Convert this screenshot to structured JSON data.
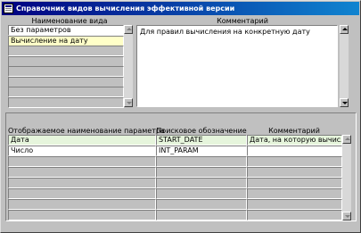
{
  "window": {
    "title": "Справочник видов вычисления эффективной версии"
  },
  "top": {
    "kinds_header": "Наименование вида",
    "comment_header": "Комментарий",
    "kinds": [
      "Без параметров",
      "Вычисление на дату",
      "",
      "",
      "",
      "",
      "",
      ""
    ],
    "selected_index": 1,
    "comment_text": "Для правил вычисления на конкретную дату"
  },
  "params": {
    "headers": [
      "Отображаемое наименование параметра",
      "Поисковое обозначение",
      "Комментарий"
    ],
    "rows": [
      [
        "Дата",
        "START_DATE",
        "Дата, на которую вычислят"
      ],
      [
        "Число",
        "INT_PARAM",
        ""
      ],
      [
        "",
        "",
        ""
      ],
      [
        "",
        "",
        ""
      ],
      [
        "",
        "",
        ""
      ],
      [
        "",
        "",
        ""
      ],
      [
        "",
        "",
        ""
      ],
      [
        "",
        "",
        ""
      ]
    ]
  },
  "colors": {
    "title_start": "#000080",
    "title_end": "#1084d0",
    "face": "#c0c0c0",
    "selected_row": "#ffffc8",
    "current_row": "#e6f5dc"
  }
}
